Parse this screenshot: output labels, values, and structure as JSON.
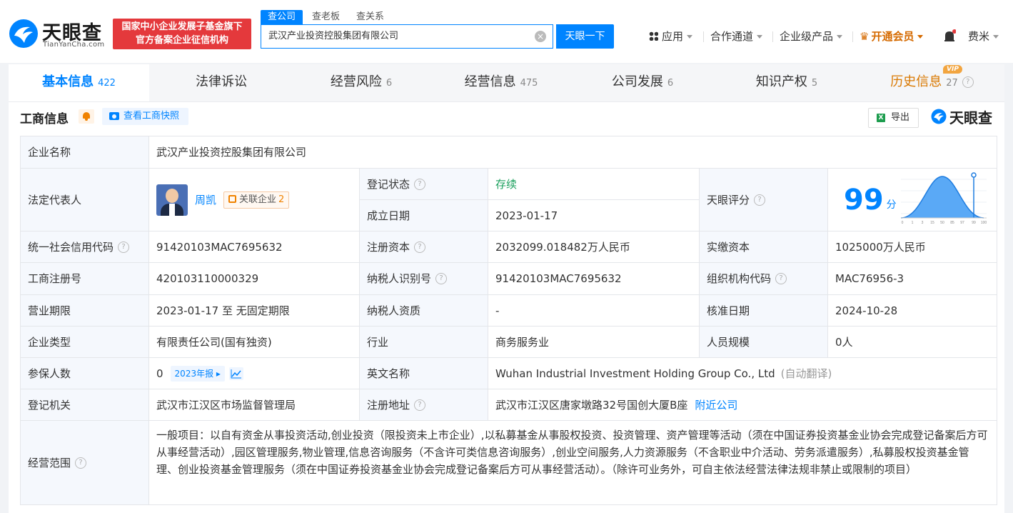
{
  "header": {
    "logo_cn": "天眼查",
    "logo_en": "TianYanCha.com",
    "badge_line1": "国家中小企业发展子基金旗下",
    "badge_line2": "官方备案企业征信机构",
    "search_tabs": [
      "查公司",
      "查老板",
      "查关系"
    ],
    "search_value": "武汉产业投资控股集团有限公司",
    "search_button": "天眼一下",
    "nav": {
      "apps": "应用",
      "channel": "合作通道",
      "enterprise": "企业级产品",
      "vip": "开通会员",
      "user": "费米"
    }
  },
  "tabs": [
    {
      "label": "基本信息",
      "count": "422"
    },
    {
      "label": "法律诉讼",
      "count": ""
    },
    {
      "label": "经营风险",
      "count": "6"
    },
    {
      "label": "经营信息",
      "count": "475"
    },
    {
      "label": "公司发展",
      "count": "6"
    },
    {
      "label": "知识产权",
      "count": "5"
    },
    {
      "label": "历史信息",
      "count": "27"
    }
  ],
  "vip_tag": "VIP",
  "section": {
    "title": "工商信息",
    "snapshot": "查看工商快照",
    "export": "导出",
    "watermark": "天眼查"
  },
  "info": {
    "company_name_label": "企业名称",
    "company_name": "武汉产业投资控股集团有限公司",
    "legal_rep_label": "法定代表人",
    "legal_rep": "周凯",
    "related_label": "关联企业",
    "related_count": "2",
    "reg_status_label": "登记状态",
    "reg_status": "存续",
    "established_label": "成立日期",
    "established": "2023-01-17",
    "score_label": "天眼评分",
    "score": "99",
    "score_unit": "分",
    "score_axis": [
      "0",
      "1",
      "3",
      "15",
      "50",
      "85",
      "97",
      "99",
      "100"
    ],
    "credit_code_label": "统一社会信用代码",
    "credit_code": "91420103MAC7695632",
    "reg_capital_label": "注册资本",
    "reg_capital": "2032099.018482万人民币",
    "paid_capital_label": "实缴资本",
    "paid_capital": "1025000万人民币",
    "reg_no_label": "工商注册号",
    "reg_no": "420103110000329",
    "taxpayer_id_label": "纳税人识别号",
    "taxpayer_id": "91420103MAC7695632",
    "org_code_label": "组织机构代码",
    "org_code": "MAC76956-3",
    "term_label": "营业期限",
    "term": "2023-01-17 至 无固定期限",
    "taxpayer_qual_label": "纳税人资质",
    "taxpayer_qual": "-",
    "approval_date_label": "核准日期",
    "approval_date": "2024-10-28",
    "company_type_label": "企业类型",
    "company_type": "有限责任公司(国有独资)",
    "industry_label": "行业",
    "industry": "商务服务业",
    "staff_size_label": "人员规模",
    "staff_size": "0人",
    "insured_label": "参保人数",
    "insured": "0",
    "annual_report": "2023年报",
    "english_name_label": "英文名称",
    "english_name": "Wuhan Industrial Investment Holding Group Co., Ltd",
    "auto_translate": "(自动翻译)",
    "authority_label": "登记机关",
    "authority": "武汉市江汉区市场监督管理局",
    "address_label": "注册地址",
    "address": "武汉市江汉区唐家墩路32号国创大厦B座",
    "nearby": "附近公司",
    "scope_label": "经营范围",
    "scope": "一般项目：以自有资金从事投资活动,创业投资（限投资未上市企业）,以私募基金从事股权投资、投资管理、资产管理等活动（须在中国证券投资基金业协会完成登记备案后方可从事经营活动）,园区管理服务,物业管理,信息咨询服务（不含许可类信息咨询服务）,创业空间服务,人力资源服务（不含职业中介活动、劳务派遣服务）,私募股权投资基金管理、创业投资基金管理服务（须在中国证券投资基金业协会完成登记备案后方可从事经营活动）。（除许可业务外，可自主依法经营法律法规非禁止或限制的项目）"
  },
  "colors": {
    "accent": "#0084ff",
    "vip": "#d56a00",
    "status_green": "#1ba05d"
  }
}
